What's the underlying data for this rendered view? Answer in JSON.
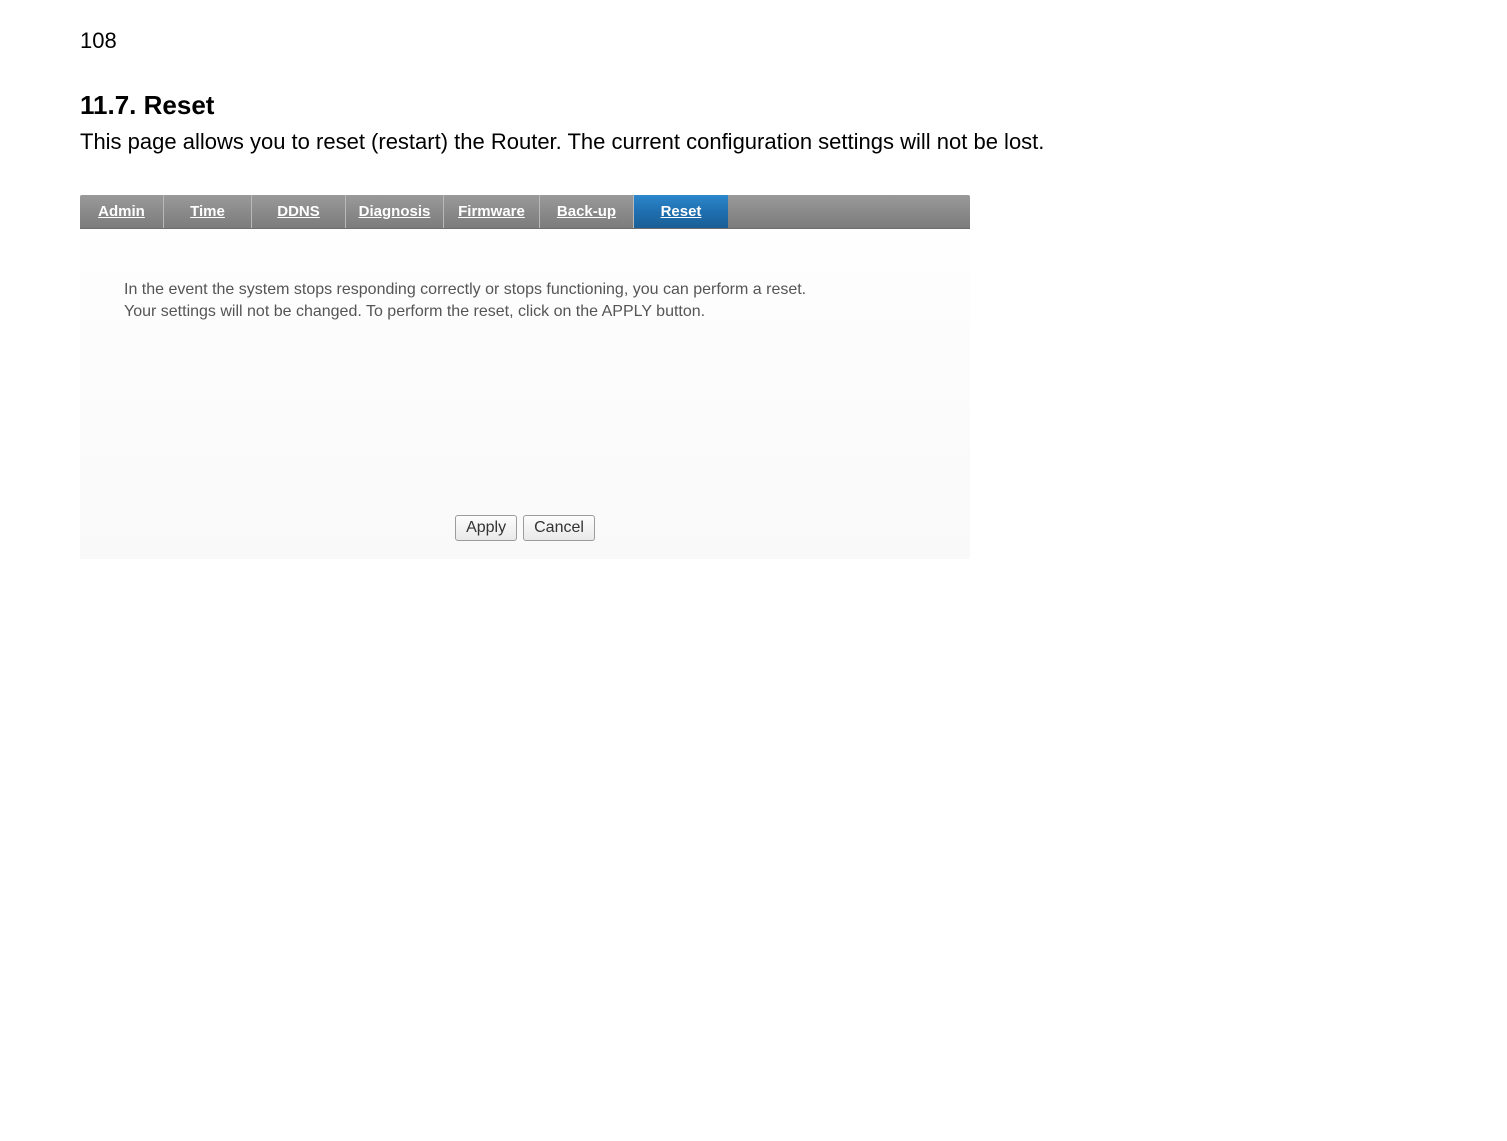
{
  "page_number": "108",
  "section": {
    "heading": "11.7.  Reset",
    "intro": "This page allows you to reset (restart) the Router. The current configuration settings will not be lost."
  },
  "tabs": {
    "items": [
      {
        "label": "Admin"
      },
      {
        "label": "Time"
      },
      {
        "label": "DDNS"
      },
      {
        "label": "Diagnosis"
      },
      {
        "label": "Firmware"
      },
      {
        "label": "Back-up"
      },
      {
        "label": "Reset"
      }
    ],
    "active_index": 6
  },
  "panel": {
    "text_line1": "In the event the system stops responding correctly or stops functioning, you can perform a reset.",
    "text_line2": "Your settings will not be changed. To perform the reset, click on the APPLY button."
  },
  "buttons": {
    "apply": "Apply",
    "cancel": "Cancel"
  }
}
